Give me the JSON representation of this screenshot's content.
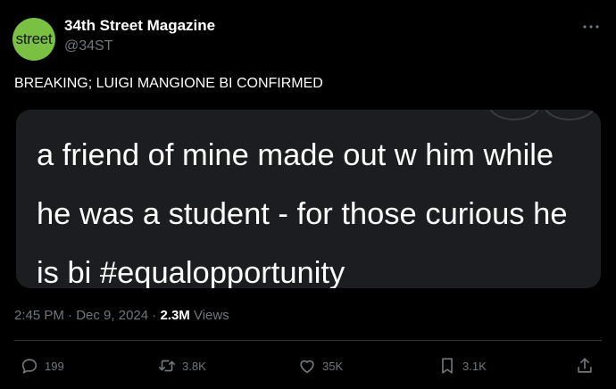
{
  "author": {
    "avatar_text": "street",
    "display_name": "34th Street Magazine",
    "handle": "@34ST"
  },
  "tweet": {
    "text": "BREAKING; LUIGI MANGIONE BI CONFIRMED",
    "media_text": "a friend of mine made out w him while he was a student - for those curious he is bi #equalopportunity",
    "time": "2:45 PM",
    "date": "Dec 9, 2024",
    "views": "2.3M",
    "views_label": "Views"
  },
  "actions": {
    "replies": "199",
    "reposts": "3.8K",
    "likes": "35K",
    "bookmarks": "3.1K"
  },
  "colors": {
    "background": "#000000",
    "avatar_bg": "#7ac143",
    "media_bg": "#1c1d20",
    "secondary_text": "#71767b",
    "divider": "#2f3336"
  },
  "icons": [
    "more-icon",
    "reply-icon",
    "repost-icon",
    "like-icon",
    "bookmark-icon",
    "share-icon"
  ]
}
